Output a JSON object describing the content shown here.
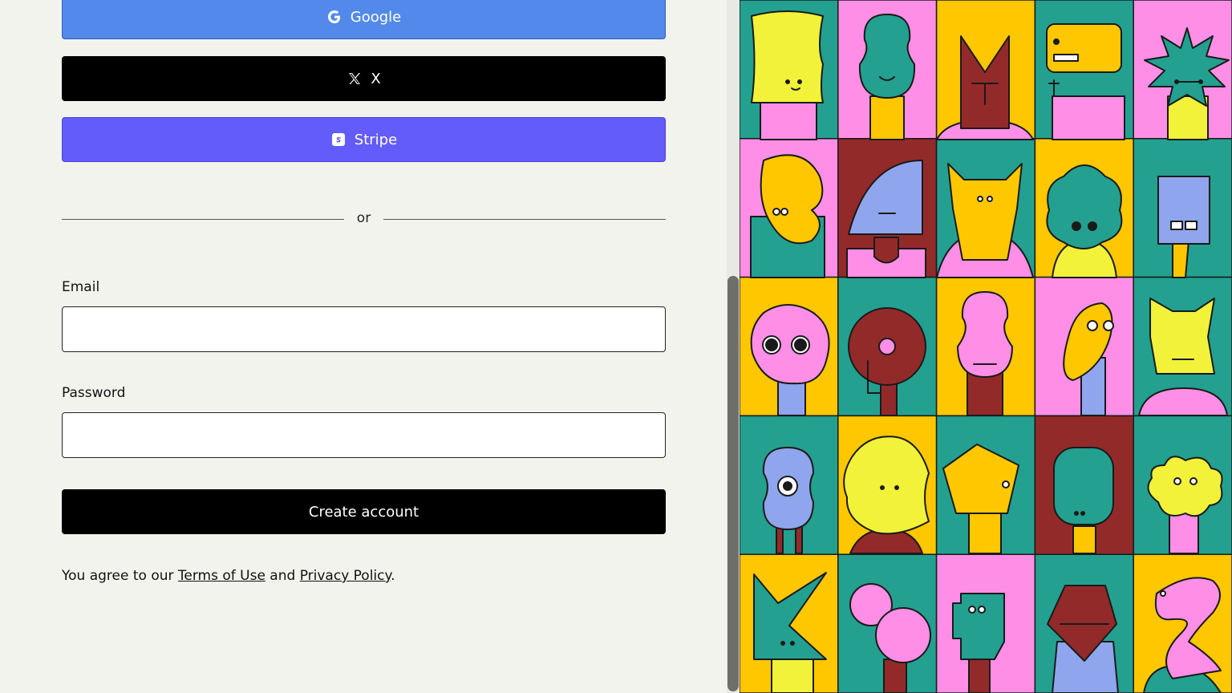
{
  "auth": {
    "google_label": "Google",
    "x_label": "X",
    "stripe_label": "Stripe",
    "divider_text": "or"
  },
  "form": {
    "email_label": "Email",
    "email_value": "",
    "email_placeholder": "",
    "password_label": "Password",
    "password_value": "",
    "password_placeholder": "",
    "submit_label": "Create account"
  },
  "legal": {
    "prefix": "You agree to our ",
    "terms_label": "Terms of Use",
    "and_text": " and ",
    "privacy_label": "Privacy Policy",
    "suffix": "."
  },
  "colors": {
    "google": "#5289ea",
    "x": "#000000",
    "stripe": "#635bfa",
    "teal": "#23a090",
    "pink": "#ff8fe6",
    "yellow": "#ffc700",
    "maroon": "#932a2a",
    "lemon": "#f2f23a",
    "periwinkle": "#8fa6ee"
  },
  "art": {
    "grid": [
      [
        "teal",
        "pink",
        "yellow",
        "teal",
        "pink"
      ],
      [
        "pink",
        "maroon",
        "teal",
        "yellow",
        "teal"
      ],
      [
        "yellow",
        "teal",
        "yellow",
        "pink",
        "teal"
      ],
      [
        "teal",
        "yellow",
        "teal",
        "maroon",
        "teal"
      ],
      [
        "yellow",
        "teal",
        "pink",
        "teal",
        "yellow"
      ]
    ]
  }
}
